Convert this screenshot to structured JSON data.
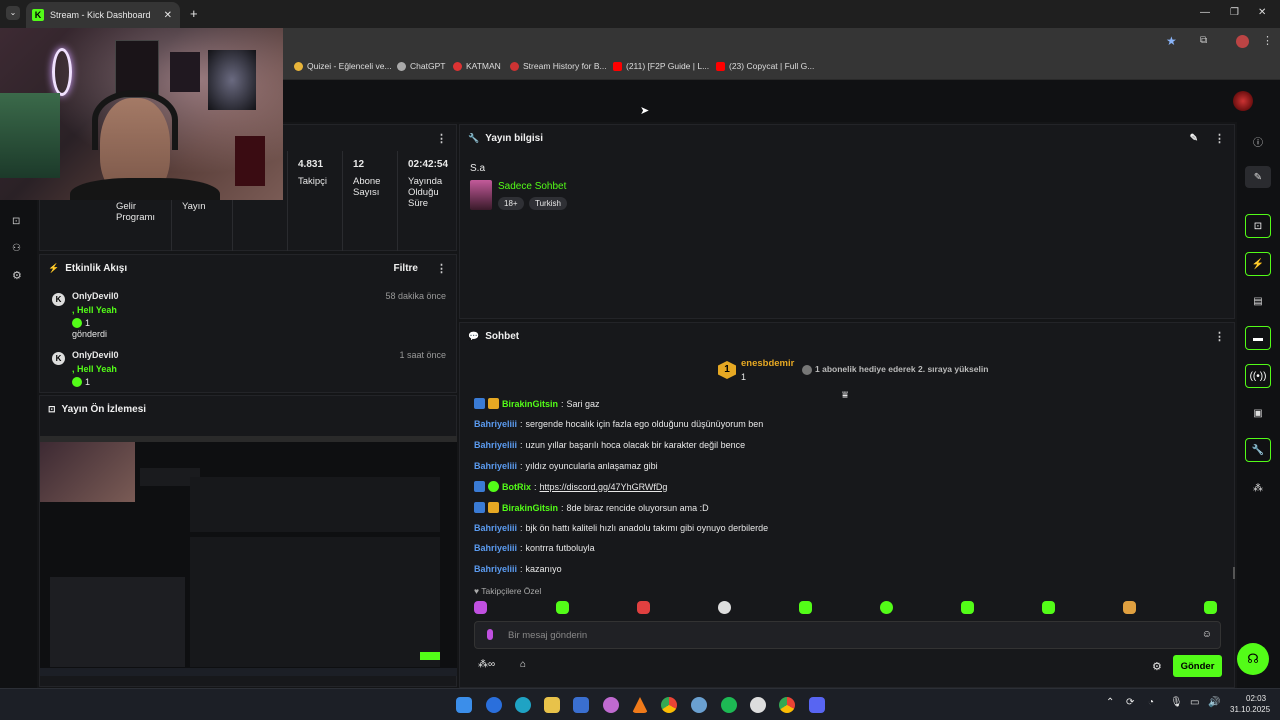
{
  "browser": {
    "tab_title": "Stream - Kick Dashboard",
    "bookmarks": [
      "Quizei - Eğlenceli ve...",
      "ChatGPT",
      "KATMAN",
      "Stream History for B...",
      "(211) [F2P Guide | L...",
      "(23) Copycat | Full G..."
    ]
  },
  "stats": {
    "cells": [
      {
        "value": "",
        "label": "Gelir Programı"
      },
      {
        "value": "",
        "label": "Yayın"
      },
      {
        "value": "",
        "label": ""
      },
      {
        "value": "4.831",
        "label": "Takipçi"
      },
      {
        "value": "12",
        "label": "Abone Sayısı"
      },
      {
        "value": "02:42:54",
        "label": "Yayında Olduğu Süre"
      }
    ]
  },
  "activity": {
    "title": "Etkinlik Akışı",
    "filter": "Filtre",
    "items": [
      {
        "user": "OnlyDevil0",
        "text": ", Hell Yeah",
        "amount": "1",
        "extra": "gönderdi",
        "time": "58 dakika önce"
      },
      {
        "user": "OnlyDevil0",
        "text": ", Hell Yeah",
        "amount": "1",
        "extra": "",
        "time": "1 saat önce"
      }
    ]
  },
  "preview": {
    "title": "Yayın Ön İzlemesi"
  },
  "stream_info": {
    "title": "Yayın bilgisi",
    "stream_title": "S.a",
    "category": "Sadece Sohbet",
    "tags": [
      "18+",
      "Turkish"
    ]
  },
  "chat": {
    "title": "Sohbet",
    "top_gifter": {
      "rank": "1",
      "name": "enesbdemir",
      "count": "1"
    },
    "gift_prompt": "1 abonelik hediye ederek 2. sıraya yükselin",
    "messages": [
      {
        "user": "BirakinGitsin",
        "text": "Sari gaz"
      },
      {
        "user": "Bahriyeliii",
        "text": "sergende hocalık için fazla ego olduğunu düşünüyorum ben"
      },
      {
        "user": "Bahriyeliii",
        "text": "uzun yıllar başarılı hoca olacak bir karakter değil bence"
      },
      {
        "user": "Bahriyeliii",
        "text": "yıldız oyuncularla anlaşamaz gibi"
      },
      {
        "user": "BotRix",
        "text": "https://discord.gg/47YhGRWfDg"
      },
      {
        "user": "BirakinGitsin",
        "text": "8de biraz rencide oluyorsun ama :D"
      },
      {
        "user": "Bahriyeliii",
        "text": "bjk ön hattı kaliteli hızlı anadolu takımı gibi oynuyo derbilerde"
      },
      {
        "user": "Bahriyeliii",
        "text": "kontrra futboluyla"
      },
      {
        "user": "Bahriyeliii",
        "text": "kazanıyo"
      }
    ],
    "followers_only": "Takipçilere Özel",
    "input_placeholder": "Bir mesaj gönderin",
    "send_label": "Gönder"
  },
  "clock": {
    "time": "02:03",
    "date": "31.10.2025"
  },
  "colors": {
    "accent": "#53fc18",
    "username_blue": "#5b9bf0",
    "panel": "#17181b",
    "background": "#101113"
  }
}
